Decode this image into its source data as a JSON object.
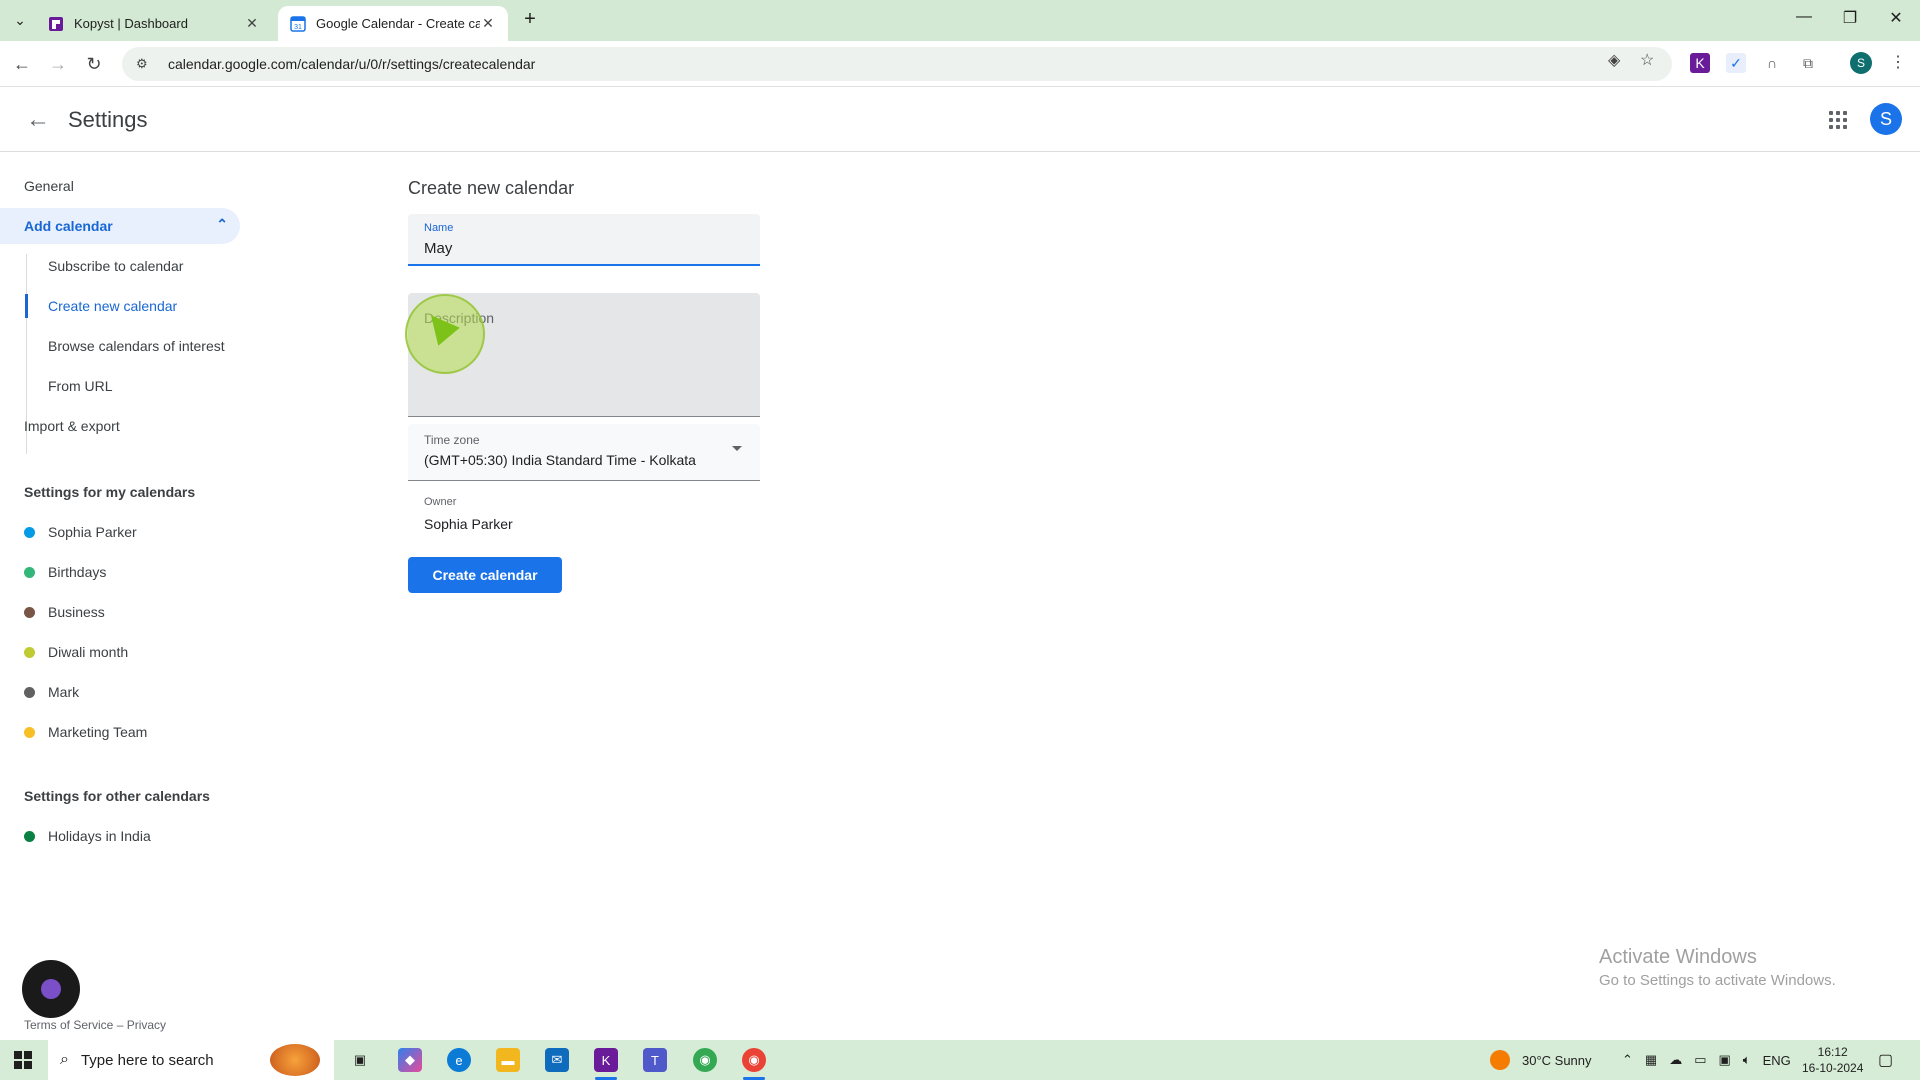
{
  "browser": {
    "tabs": [
      {
        "title": "Kopyst | Dashboard"
      },
      {
        "title": "Google Calendar - Create calen"
      }
    ],
    "url": "calendar.google.com/calendar/u/0/r/settings/createcalendar",
    "profile_initial": "S"
  },
  "app": {
    "title": "Settings",
    "avatar_initial": "S"
  },
  "sidebar": {
    "general": "General",
    "add_calendar": "Add calendar",
    "sub_items": [
      "Subscribe to calendar",
      "Create new calendar",
      "Browse calendars of interest",
      "From URL"
    ],
    "import_export": "Import & export",
    "my_calendars_heading": "Settings for my calendars",
    "my_calendars": [
      {
        "name": "Sophia Parker",
        "color": "#039be5"
      },
      {
        "name": "Birthdays",
        "color": "#33b679"
      },
      {
        "name": "Business",
        "color": "#795548"
      },
      {
        "name": "Diwali month",
        "color": "#c0ca33"
      },
      {
        "name": "Mark",
        "color": "#616161"
      },
      {
        "name": "Marketing Team",
        "color": "#f6bf26"
      }
    ],
    "other_calendars_heading": "Settings for other calendars",
    "other_calendars": [
      {
        "name": "Holidays in India",
        "color": "#0b8043"
      }
    ]
  },
  "form": {
    "title": "Create new calendar",
    "name_label": "Name",
    "name_value": "May",
    "description_label": "Description",
    "timezone_label": "Time zone",
    "timezone_value": "(GMT+05:30) India Standard Time - Kolkata",
    "owner_label": "Owner",
    "owner_value": "Sophia Parker",
    "create_button": "Create calendar"
  },
  "watermark": {
    "line1": "Activate Windows",
    "line2": "Go to Settings to activate Windows."
  },
  "footer": {
    "terms": "Terms of Service",
    "separator": " – ",
    "privacy": "Privacy"
  },
  "taskbar": {
    "search_placeholder": "Type here to search",
    "weather": "30°C  Sunny",
    "language": "ENG",
    "time": "16:12",
    "date": "16-10-2024"
  },
  "colors": {
    "accent": "#1a73e8",
    "active_nav": "#1967d2"
  }
}
